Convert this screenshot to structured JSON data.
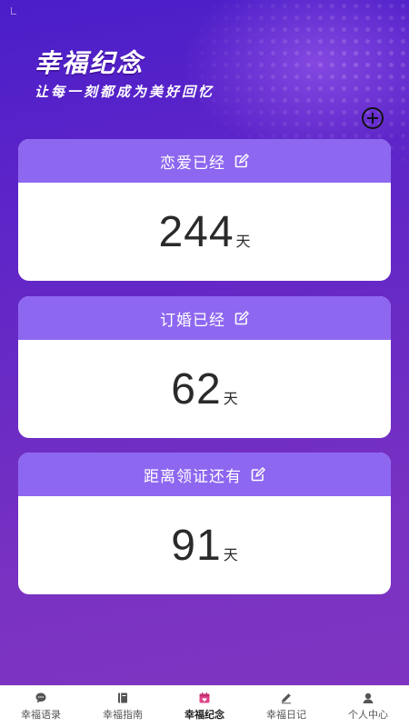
{
  "header": {
    "title": "幸福纪念",
    "subtitle": "让每一刻都成为美好回忆"
  },
  "cards": [
    {
      "label": "恋爱已经",
      "value": "244",
      "unit": "天"
    },
    {
      "label": "订婚已经",
      "value": "62",
      "unit": "天"
    },
    {
      "label": "距离领证还有",
      "value": "91",
      "unit": "天"
    }
  ],
  "tabs": [
    {
      "label": "幸福语录",
      "icon": "chat-icon"
    },
    {
      "label": "幸福指南",
      "icon": "book-icon"
    },
    {
      "label": "幸福纪念",
      "icon": "calendar-icon",
      "active": true
    },
    {
      "label": "幸福日记",
      "icon": "pencil-icon"
    },
    {
      "label": "个人中心",
      "icon": "user-icon"
    }
  ],
  "colors": {
    "card_header": "#8e67f0",
    "active_icon": "#e0448a"
  }
}
